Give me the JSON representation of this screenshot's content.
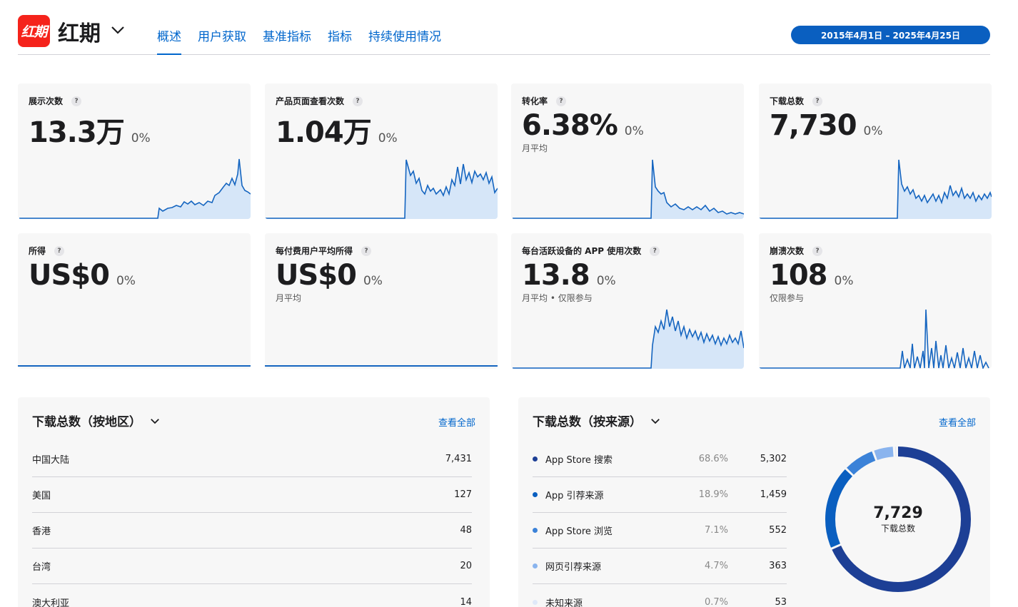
{
  "app": {
    "icon_text": "红期",
    "name": "红期"
  },
  "tabs": [
    {
      "label": "概述",
      "active": true
    },
    {
      "label": "用户获取"
    },
    {
      "label": "基准指标"
    },
    {
      "label": "指标"
    },
    {
      "label": "持续使用情况"
    }
  ],
  "date_range": "2015年4月1日 – 2025年4月25日",
  "metrics": [
    {
      "label": "展示次数",
      "value": "13.3万",
      "change": "0%",
      "sub": ""
    },
    {
      "label": "产品页面查看次数",
      "value": "1.04万",
      "change": "0%",
      "sub": ""
    },
    {
      "label": "转化率",
      "value": "6.38%",
      "change": "0%",
      "sub": "月平均"
    },
    {
      "label": "下载总数",
      "value": "7,730",
      "change": "0%",
      "sub": ""
    },
    {
      "label": "所得",
      "value": "US$0",
      "change": "0%",
      "sub": ""
    },
    {
      "label": "每付费用户平均所得",
      "value": "US$0",
      "change": "0%",
      "sub": "月平均"
    },
    {
      "label": "每台活跃设备的 APP 使用次数",
      "value": "13.8",
      "change": "0%",
      "sub": "月平均 • 仅限参与"
    },
    {
      "label": "崩溃次数",
      "value": "108",
      "change": "0%",
      "sub": "仅限参与"
    }
  ],
  "region_panel": {
    "title": "下载总数（按地区）",
    "view_all": "查看全部",
    "rows": [
      {
        "name": "中国大陆",
        "value": "7,431"
      },
      {
        "name": "美国",
        "value": "127"
      },
      {
        "name": "香港",
        "value": "48"
      },
      {
        "name": "台湾",
        "value": "20"
      },
      {
        "name": "澳大利亚",
        "value": "14"
      }
    ]
  },
  "source_panel": {
    "title": "下载总数（按来源）",
    "view_all": "查看全部",
    "rows": [
      {
        "name": "App Store 搜索",
        "share": "68.6%",
        "value": "5,302",
        "color": "#1d3f95"
      },
      {
        "name": "App 引荐来源",
        "share": "18.9%",
        "value": "1,459",
        "color": "#0a5fc0"
      },
      {
        "name": "App Store 浏览",
        "share": "7.1%",
        "value": "552",
        "color": "#3b82d8"
      },
      {
        "name": "网页引荐来源",
        "share": "4.7%",
        "value": "363",
        "color": "#8ab4ee"
      },
      {
        "name": "未知来源",
        "share": "0.7%",
        "value": "53",
        "color": "#dfe8f8"
      }
    ],
    "donut": {
      "total": "7,729",
      "label": "下载总数"
    }
  },
  "colors": {
    "accent": "#0066cc",
    "chart_line": "#1565c0",
    "chart_fill": "#d6e6f8",
    "brand": "#f5231b"
  }
}
